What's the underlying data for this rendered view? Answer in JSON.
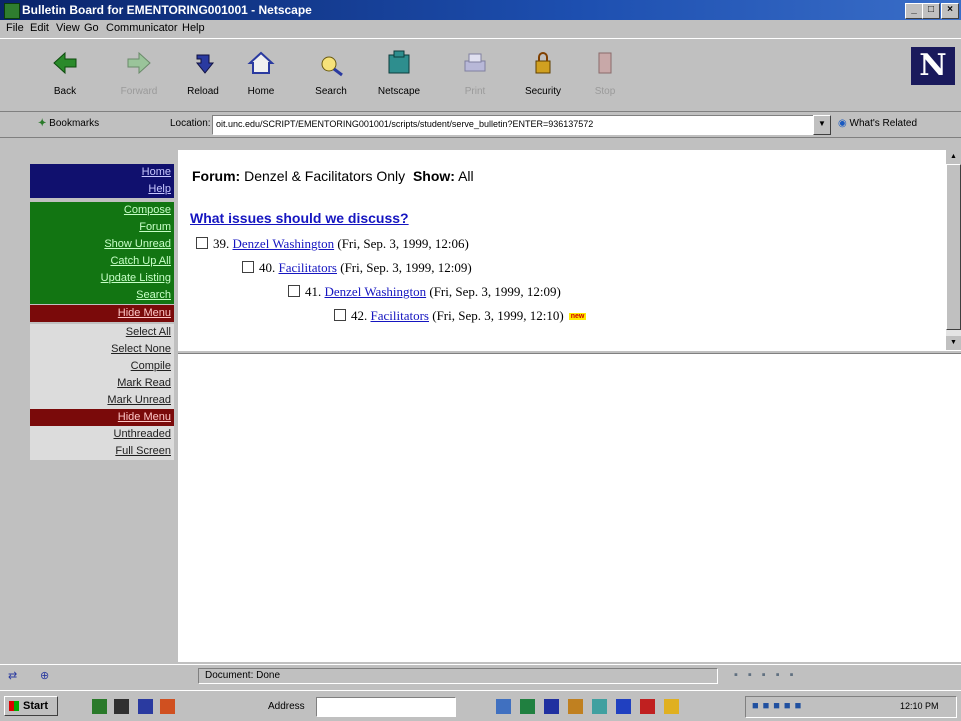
{
  "window": {
    "title": "Bulletin Board for EMENTORING001001 - Netscape",
    "controls": [
      "_",
      "□",
      "×"
    ]
  },
  "menubar": [
    "File",
    "Edit",
    "View",
    "Go",
    "Communicator",
    "Help"
  ],
  "nav_toolbar": {
    "buttons": [
      {
        "label": "Back",
        "icon": "back-arrow-icon",
        "enabled": true
      },
      {
        "label": "Forward",
        "icon": "forward-arrow-icon",
        "enabled": false
      },
      {
        "label": "Reload",
        "icon": "reload-icon",
        "enabled": true
      },
      {
        "label": "Home",
        "icon": "home-icon",
        "enabled": true
      },
      {
        "label": "Search",
        "icon": "search-icon",
        "enabled": true
      },
      {
        "label": "Netscape",
        "icon": "netscape-icon",
        "enabled": true
      },
      {
        "label": "Print",
        "icon": "print-icon",
        "enabled": false
      },
      {
        "label": "Security",
        "icon": "lock-icon",
        "enabled": true
      },
      {
        "label": "Stop",
        "icon": "stop-icon",
        "enabled": false
      }
    ],
    "logo": "N"
  },
  "location_toolbar": {
    "bookmarks_label": "Bookmarks",
    "location_label": "Location:",
    "url": "oit.unc.edu/SCRIPT/EMENTORING001001/scripts/student/serve_bulletin?ENTER=936137572",
    "related_label": "What's Related"
  },
  "left_menu": {
    "items": [
      {
        "label": "Home",
        "style": "navy"
      },
      {
        "label": "Help",
        "style": "navy"
      },
      {
        "label": "Compose",
        "style": "green"
      },
      {
        "label": "Forum",
        "style": "green"
      },
      {
        "label": "Show Unread",
        "style": "green"
      },
      {
        "label": "Catch Up All",
        "style": "green"
      },
      {
        "label": "Update Listing",
        "style": "green"
      },
      {
        "label": "Search",
        "style": "green"
      },
      {
        "label": "Hide Menu",
        "style": "red"
      },
      {
        "label": "Select All",
        "style": "grey"
      },
      {
        "label": "Select None",
        "style": "grey"
      },
      {
        "label": "Compile",
        "style": "grey"
      },
      {
        "label": "Mark Read",
        "style": "grey"
      },
      {
        "label": "Mark Unread",
        "style": "grey"
      },
      {
        "label": "Hide Menu",
        "style": "red"
      },
      {
        "label": "Unthreaded",
        "style": "grey"
      },
      {
        "label": "Full Screen",
        "style": "grey"
      }
    ]
  },
  "forum": {
    "forum_label": "Forum:",
    "forum_name": "Denzel & Facilitators Only",
    "show_label": "Show:",
    "show_value": "All",
    "thread_title": "What issues should we discuss?",
    "posts": [
      {
        "number": "39.",
        "author": "Denzel Washington",
        "date": "(Fri, Sep. 3, 1999, 12:06)",
        "depth": 0,
        "new": false
      },
      {
        "number": "40.",
        "author": "Facilitators",
        "date": "(Fri, Sep. 3, 1999, 12:09)",
        "depth": 1,
        "new": false
      },
      {
        "number": "41.",
        "author": "Denzel Washington",
        "date": "(Fri, Sep. 3, 1999, 12:09)",
        "depth": 2,
        "new": false
      },
      {
        "number": "42.",
        "author": "Facilitators",
        "date": "(Fri, Sep. 3, 1999, 12:10)",
        "depth": 3,
        "new": true
      }
    ],
    "new_badge": "new"
  },
  "status": {
    "text": "Document: Done"
  },
  "taskbar": {
    "start_label": "Start",
    "address_label": "Address",
    "clock": "12:10 PM"
  }
}
